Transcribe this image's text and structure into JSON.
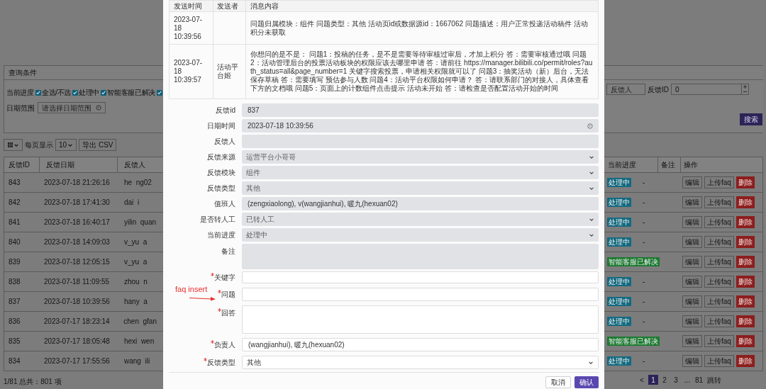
{
  "query_panel": {
    "title": "查询条件",
    "progress_label": "当前进度",
    "checkboxes": [
      {
        "label": "全选/不选",
        "checked": true
      },
      {
        "label": "处理中",
        "checked": true
      },
      {
        "label": "智能客服已解决",
        "checked": true
      },
      {
        "checked": true
      }
    ],
    "date_label": "日期范围",
    "date_placeholder": "请选择日期范围",
    "person_placeholder": "反馈人",
    "id_label": "反馈ID",
    "id_value": "0",
    "search_button": "搜索"
  },
  "toolbar": {
    "page_size_label": "每页显示",
    "page_size": "10",
    "export_button": "导出 CSV"
  },
  "table": {
    "columns": [
      "反馈ID",
      "反馈日期",
      "反馈人"
    ],
    "right_columns": [
      "当前进度",
      "备注",
      "操作"
    ],
    "rows": [
      {
        "id": "843",
        "date": "2023-07-18 21:26:16",
        "person": "he  ng02",
        "status": "处理中",
        "color": "#136a80",
        "remark": "-",
        "actions": [
          {
            "label": "编辑",
            "kind": "default"
          },
          {
            "label": "上传faq",
            "kind": "default"
          },
          {
            "label": "删除",
            "kind": "danger"
          }
        ]
      },
      {
        "id": "842",
        "date": "2023-07-18 17:41:30",
        "person": "dai  i",
        "status": "处理中",
        "color": "#136a80",
        "remark": "-",
        "actions": [
          {
            "label": "编辑",
            "kind": "default"
          },
          {
            "label": "上传faq",
            "kind": "default"
          },
          {
            "label": "删除",
            "kind": "danger"
          }
        ]
      },
      {
        "id": "841",
        "date": "2023-07-18 16:40:17",
        "person": "yilin  quan",
        "status": "处理中",
        "color": "#136a80",
        "remark": "-",
        "actions": [
          {
            "label": "编辑",
            "kind": "default"
          },
          {
            "label": "上传faq",
            "kind": "default"
          },
          {
            "label": "删除",
            "kind": "danger"
          }
        ]
      },
      {
        "id": "840",
        "date": "2023-07-18 14:09:03",
        "person": "v_yu  a",
        "status": "处理中",
        "color": "#136a80",
        "remark": "-",
        "actions": [
          {
            "label": "编辑",
            "kind": "default"
          },
          {
            "label": "上传faq",
            "kind": "default"
          },
          {
            "label": "删除",
            "kind": "danger"
          }
        ]
      },
      {
        "id": "839",
        "date": "2023-07-18 12:05:15",
        "person": "v_yu  a",
        "status": "智能客服已解决",
        "color": "#1b7a30",
        "actions": [
          {
            "label": "编辑",
            "kind": "default"
          },
          {
            "label": "上传faq",
            "kind": "default"
          },
          {
            "label": "删除",
            "kind": "danger"
          }
        ]
      },
      {
        "id": "838",
        "date": "2023-07-18 11:09:55",
        "person": "zhou  n",
        "status": "处理中",
        "color": "#136a80",
        "remark": "-",
        "actions": [
          {
            "label": "编辑",
            "kind": "default"
          },
          {
            "label": "上传faq",
            "kind": "default"
          },
          {
            "label": "删除",
            "kind": "danger"
          }
        ]
      },
      {
        "id": "837",
        "date": "2023-07-18 10:39:56",
        "person": "hany  a",
        "status": "处理中",
        "color": "#136a80",
        "remark": "-",
        "actions": [
          {
            "label": "编辑",
            "kind": "default"
          },
          {
            "label": "上传faq",
            "kind": "default"
          },
          {
            "label": "删除",
            "kind": "danger"
          }
        ]
      },
      {
        "id": "836",
        "date": "2023-07-17 18:23:14",
        "person": "chen  gfan",
        "status": "处理中",
        "color": "#136a80",
        "remark": "-",
        "actions": [
          {
            "label": "编辑",
            "kind": "default"
          },
          {
            "label": "上传faq",
            "kind": "default"
          },
          {
            "label": "删除",
            "kind": "danger"
          }
        ]
      },
      {
        "id": "835",
        "date": "2023-07-17 18:05:48",
        "person": "hexi  wen",
        "status": "智能客服已解决",
        "color": "#1b7a30",
        "actions": [
          {
            "label": "编辑",
            "kind": "default"
          },
          {
            "label": "上传faq",
            "kind": "default"
          },
          {
            "label": "删除",
            "kind": "danger"
          }
        ]
      },
      {
        "id": "834",
        "date": "2023-07-17 17:55:56",
        "person": "wang  ili",
        "status": "处理中",
        "color": "#136a80",
        "remark": "-",
        "actions": [
          {
            "label": "编辑",
            "kind": "default"
          },
          {
            "label": "上传faq",
            "kind": "default"
          },
          {
            "label": "删除",
            "kind": "danger"
          }
        ]
      }
    ]
  },
  "footer": {
    "summary": "1/81 总共：801 项"
  },
  "pagination": [
    {
      "label": "<",
      "selected": false
    },
    {
      "label": "1",
      "selected": true
    },
    {
      "label": "2",
      "selected": false
    },
    {
      "label": "3",
      "selected": false
    },
    {
      "label": "...",
      "selected": false
    },
    {
      "label": "81",
      "selected": false
    },
    {
      "label": "跳转",
      "selected": false
    }
  ],
  "modal": {
    "messages": {
      "columns": [
        "发送时间",
        "发送者",
        "消息内容"
      ],
      "rows": [
        {
          "time": "2023-07-18 10:39:56",
          "content": "问题归属模块：组件 问题类型：其他 活动页id或数据源id：1667062 问题描述：用户正常投递活动稿件 活动积分未获取"
        },
        {
          "time": "2023-07-18 10:39:57",
          "sender": "活动平台姬",
          "content": "你想问的是不是： 问题1：投稿的任务，是不是需要等待审核过审后，才加上积分 答：需要审核通过哦 问题2：活动管理后台的投票活动板块的权限应该去哪里申请 答：请前往 https://manager.bilibili.co/permit/roles?auth_status=all&page_number=1 关键字搜索投票，申请相关权限就可以了 问题3：抽奖活动（新）后台，无法保存草稿 答：需要填写 预估参与人数 问题4：活动平台权限如何申请？ 答：请联系部门的对接人，具体查看下方的文档哦 问题5：页面上的计数组件点击提示 活动未开始 答：请检查是否配置活动开始的时间"
        }
      ]
    },
    "fields": [
      {
        "label": "反馈id",
        "kind": "input",
        "value": "837",
        "disabled": true,
        "required": false
      },
      {
        "label": "日期时间",
        "kind": "datetime",
        "value": "2023-07-18 10:39:56",
        "disabled": true,
        "required": false
      },
      {
        "label": "反馈人",
        "kind": "input",
        "disabled": true,
        "required": false
      },
      {
        "label": "反馈来源",
        "kind": "select",
        "value": "运营平台小哥哥",
        "disabled": true,
        "required": false
      },
      {
        "label": "反馈模块",
        "kind": "select",
        "value": "组件",
        "disabled": true,
        "required": false
      },
      {
        "label": "反馈类型",
        "kind": "select",
        "value": "其他",
        "disabled": true,
        "required": false
      },
      {
        "label": "值班人",
        "kind": "input",
        "value": "(zengxiaolong), v(wangjianhui), 暖九(hexuan02)",
        "disabled": true,
        "required": false
      },
      {
        "label": "是否转人工",
        "kind": "select",
        "value": "已转人工",
        "disabled": true,
        "required": false
      },
      {
        "label": "当前进度",
        "kind": "select",
        "value": "处理中",
        "disabled": true,
        "required": false
      },
      {
        "label": "备注",
        "kind": "textarea",
        "disabled": true,
        "required": false
      },
      {
        "label": "关键字",
        "kind": "input",
        "disabled": false,
        "required": true
      },
      {
        "label": "问题",
        "kind": "input",
        "disabled": false,
        "required": true
      },
      {
        "label": "回答",
        "kind": "textarea",
        "disabled": false,
        "required": true
      },
      {
        "label": "负责人",
        "kind": "input",
        "value": "(wangjianhui), 暖九(hexuan02)",
        "disabled": false,
        "required": true
      },
      {
        "label": "反馈类型",
        "kind": "select",
        "value": "其他",
        "disabled": false,
        "required": true
      }
    ],
    "annotation": "faq insert",
    "buttons": [
      {
        "label": "取消",
        "kind": "default"
      },
      {
        "label": "确认",
        "kind": "primary"
      }
    ]
  }
}
